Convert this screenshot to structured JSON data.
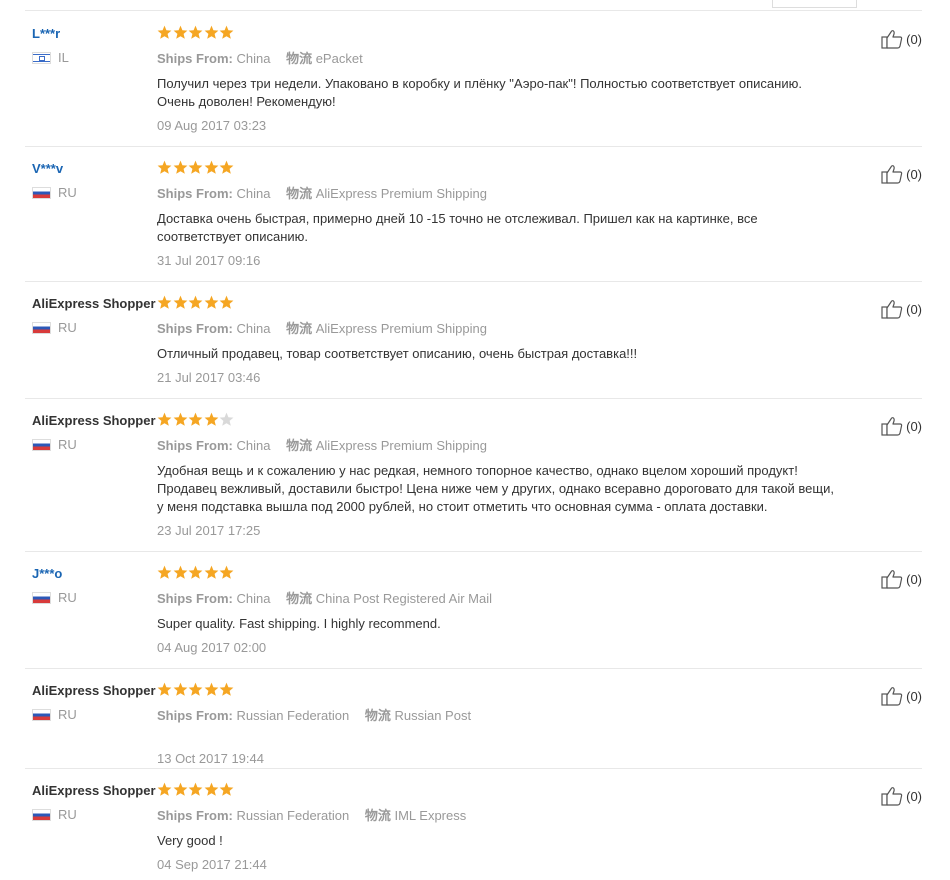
{
  "labels": {
    "ships_from": "Ships From:",
    "logistics": "物流"
  },
  "colors": {
    "star_filled": "#f5a623",
    "star_empty": "#d9d9d9",
    "masked_name": "#1a65b3"
  },
  "reviews": [
    {
      "name": "L***r",
      "country": "IL",
      "rating": 5,
      "ships_from": "China",
      "logistics": "ePacket",
      "text": "Получил через три недели. Упаковано в коробку и плёнку \"Аэро-пак\"! Полностью соответствует описанию. Очень доволен! Рекомендую!",
      "date": "09 Aug 2017 03:23",
      "helpful": "(0)"
    },
    {
      "name": "V***v",
      "country": "RU",
      "rating": 5,
      "ships_from": "China",
      "logistics": "AliExpress Premium Shipping",
      "text": "Доставка очень быстрая, примерно дней 10 -15 точно не отслеживал. Пришел как на картинке, все соответствует описанию.",
      "date": "31 Jul 2017 09:16",
      "helpful": "(0)"
    },
    {
      "name": "AliExpress Shopper",
      "country": "RU",
      "rating": 5,
      "ships_from": "China",
      "logistics": "AliExpress Premium Shipping",
      "text": "Отличный продавец, товар соответствует описанию, очень быстрая доставка!!!",
      "date": "21 Jul 2017 03:46",
      "helpful": "(0)"
    },
    {
      "name": "AliExpress Shopper",
      "country": "RU",
      "rating": 4,
      "ships_from": "China",
      "logistics": "AliExpress Premium Shipping",
      "text": "Удобная вещь и к сожалению у нас редкая, немного топорное качество, однако вцелом хороший продукт! Продавец вежливый, доставили быстро! Цена ниже чем у других, однако всеравно дороговато для такой вещи, у меня подставка вышла под 2000 рублей, но стоит отметить что основная сумма - оплата доставки.",
      "date": "23 Jul 2017 17:25",
      "helpful": "(0)"
    },
    {
      "name": "J***o",
      "country": "RU",
      "rating": 5,
      "ships_from": "China",
      "logistics": "China Post Registered Air Mail",
      "text": "Super quality. Fast shipping. I highly recommend.",
      "date": "04 Aug 2017 02:00",
      "helpful": "(0)"
    },
    {
      "name": "AliExpress Shopper",
      "country": "RU",
      "rating": 5,
      "ships_from": "Russian Federation",
      "logistics": "Russian Post",
      "text": "",
      "date": "13 Oct 2017 19:44",
      "helpful": "(0)"
    },
    {
      "name": "AliExpress Shopper",
      "country": "RU",
      "rating": 5,
      "ships_from": "Russian Federation",
      "logistics": "IML Express",
      "text": "Very good !",
      "date": "04 Sep 2017 21:44",
      "helpful": "(0)"
    }
  ]
}
